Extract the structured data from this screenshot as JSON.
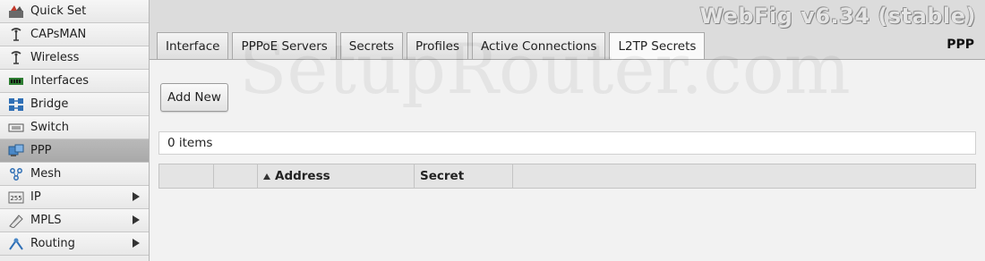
{
  "app": {
    "title": "WebFig v6.34 (stable)",
    "section": "PPP",
    "watermark": "SetupRouter.com"
  },
  "sidebar": {
    "items": [
      {
        "label": "Quick Set",
        "icon": "quick-set-icon",
        "submenu": false,
        "active": false
      },
      {
        "label": "CAPsMAN",
        "icon": "antenna-icon",
        "submenu": false,
        "active": false
      },
      {
        "label": "Wireless",
        "icon": "antenna-icon",
        "submenu": false,
        "active": false
      },
      {
        "label": "Interfaces",
        "icon": "interfaces-icon",
        "submenu": false,
        "active": false
      },
      {
        "label": "Bridge",
        "icon": "bridge-icon",
        "submenu": false,
        "active": false
      },
      {
        "label": "Switch",
        "icon": "switch-icon",
        "submenu": false,
        "active": false
      },
      {
        "label": "PPP",
        "icon": "ppp-icon",
        "submenu": false,
        "active": true
      },
      {
        "label": "Mesh",
        "icon": "mesh-icon",
        "submenu": false,
        "active": false
      },
      {
        "label": "IP",
        "icon": "ip-icon",
        "submenu": true,
        "active": false
      },
      {
        "label": "MPLS",
        "icon": "mpls-icon",
        "submenu": true,
        "active": false
      },
      {
        "label": "Routing",
        "icon": "routing-icon",
        "submenu": true,
        "active": false
      }
    ]
  },
  "tabs": [
    {
      "label": "Interface",
      "active": false
    },
    {
      "label": "PPPoE Servers",
      "active": false
    },
    {
      "label": "Secrets",
      "active": false
    },
    {
      "label": "Profiles",
      "active": false
    },
    {
      "label": "Active Connections",
      "active": false
    },
    {
      "label": "L2TP Secrets",
      "active": true
    }
  ],
  "toolbar": {
    "add_label": "Add New"
  },
  "list": {
    "count_text": "0 items"
  },
  "table": {
    "columns": [
      "",
      "",
      "Address",
      "Secret",
      ""
    ]
  }
}
